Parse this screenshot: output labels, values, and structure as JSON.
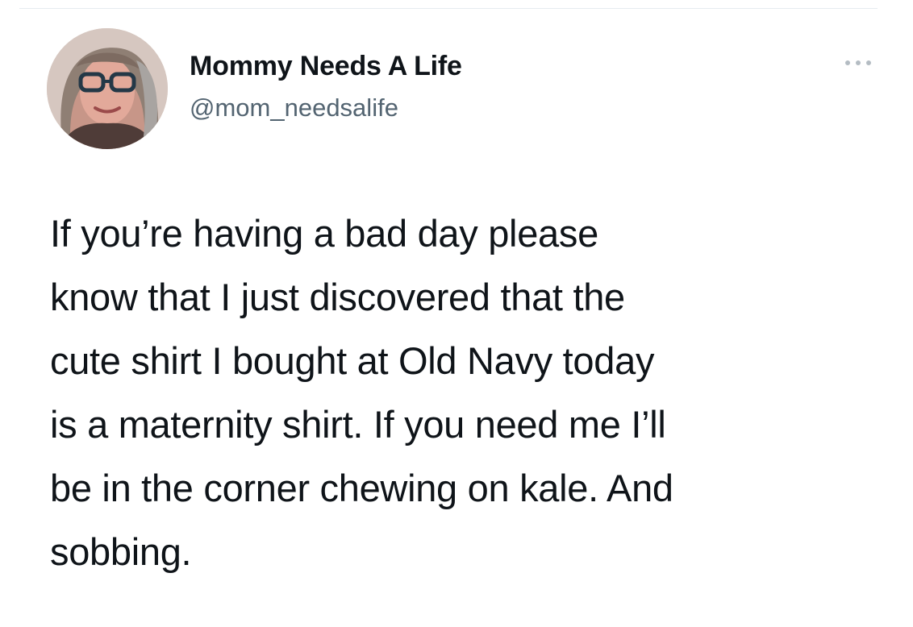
{
  "tweet": {
    "author": {
      "display_name": "Mommy Needs A Life",
      "handle": "@mom_needsalife",
      "avatar_icon": "profile-photo"
    },
    "more_icon": "more-options-icon",
    "text": "If you’re having a bad day please\nknow that I just discovered that the\ncute shirt I bought at Old Navy today\nis a maternity shirt. If you need me I’ll\nbe in the corner chewing on kale. And\nsobbing."
  },
  "colors": {
    "primary_text": "#0f1419",
    "secondary_text": "#536471",
    "background": "#ffffff"
  }
}
